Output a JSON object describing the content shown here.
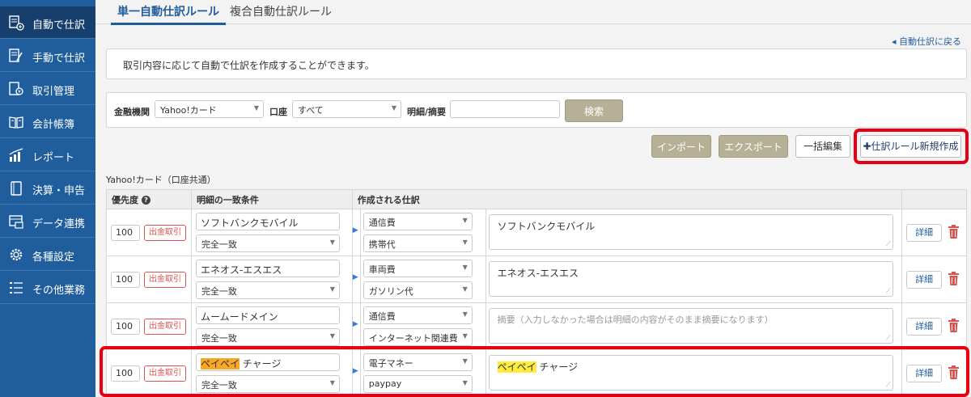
{
  "sidebar": {
    "items": [
      {
        "label": "自動で仕訳",
        "icon": "auto-journal-icon"
      },
      {
        "label": "手動で仕訳",
        "icon": "manual-journal-icon"
      },
      {
        "label": "取引管理",
        "icon": "transaction-icon"
      },
      {
        "label": "会計帳簿",
        "icon": "ledger-book-icon"
      },
      {
        "label": "レポート",
        "icon": "report-chart-icon"
      },
      {
        "label": "決算・申告",
        "icon": "settlement-icon"
      },
      {
        "label": "データ連携",
        "icon": "data-link-icon"
      },
      {
        "label": "各種設定",
        "icon": "gear-icon"
      },
      {
        "label": "その他業務",
        "icon": "list-icon"
      }
    ],
    "active_index": 0
  },
  "tabs": {
    "active": "単一自動仕訳ルール",
    "other": "複合自動仕訳ルール"
  },
  "back_link": "◂ 自動仕訳に戻る",
  "info_text": "取引内容に応じて自動で仕訳を作成することができます。",
  "filter": {
    "institution_label": "金融機関",
    "institution_value": "Yahoo!カード",
    "account_label": "口座",
    "account_value": "すべて",
    "memo_label": "明細/摘要",
    "memo_value": "",
    "search_button": "検索"
  },
  "actions": {
    "import": "インポート",
    "export": "エクスポート",
    "bulk_edit": "一括編集",
    "new_rule": "✚仕訳ルール新規作成"
  },
  "section_title": "Yahoo!カード（口座共通）",
  "table": {
    "headers": {
      "priority": "優先度",
      "condition": "明細の一致条件",
      "created": "作成される仕訳"
    },
    "help_icon": "?",
    "arrow": "▶",
    "detail_label": "詳細",
    "resize_grip": "⟋",
    "select_arrow": "▼",
    "rows": [
      {
        "priority": "100",
        "type": "出金取引",
        "match_text": "ソフトバンクモバイル",
        "match_mode": "完全一致",
        "account": "通信費",
        "sub_account": "携帯代",
        "memo": "ソフトバンクモバイル"
      },
      {
        "priority": "100",
        "type": "出金取引",
        "match_text": "エネオス-エスエス",
        "match_mode": "完全一致",
        "account": "車両費",
        "sub_account": "ガソリン代",
        "memo": "エネオス-エスエス"
      },
      {
        "priority": "100",
        "type": "出金取引",
        "match_text": "ムームードメイン",
        "match_mode": "完全一致",
        "account": "通信費",
        "sub_account": "インターネット関連費",
        "memo": "",
        "memo_placeholder": "摘要（入力しなかった場合は明細の内容がそのまま摘要になります）"
      },
      {
        "priority": "100",
        "type": "出金取引",
        "match_text_hl": "ペイペイ",
        "match_text_rest": " チャージ",
        "match_mode": "完全一致",
        "account": "電子マネー",
        "sub_account": "paypay",
        "memo_hl": "ペイペイ",
        "memo_rest": " チャージ"
      }
    ]
  },
  "colors": {
    "sidebar": "#1f5d9c",
    "sidebar_active": "#173f6d",
    "accent": "#1f5d9c",
    "highlight_border": "#e60012",
    "deposit_red": "#d9534f",
    "gray_button": "#b6b196"
  }
}
